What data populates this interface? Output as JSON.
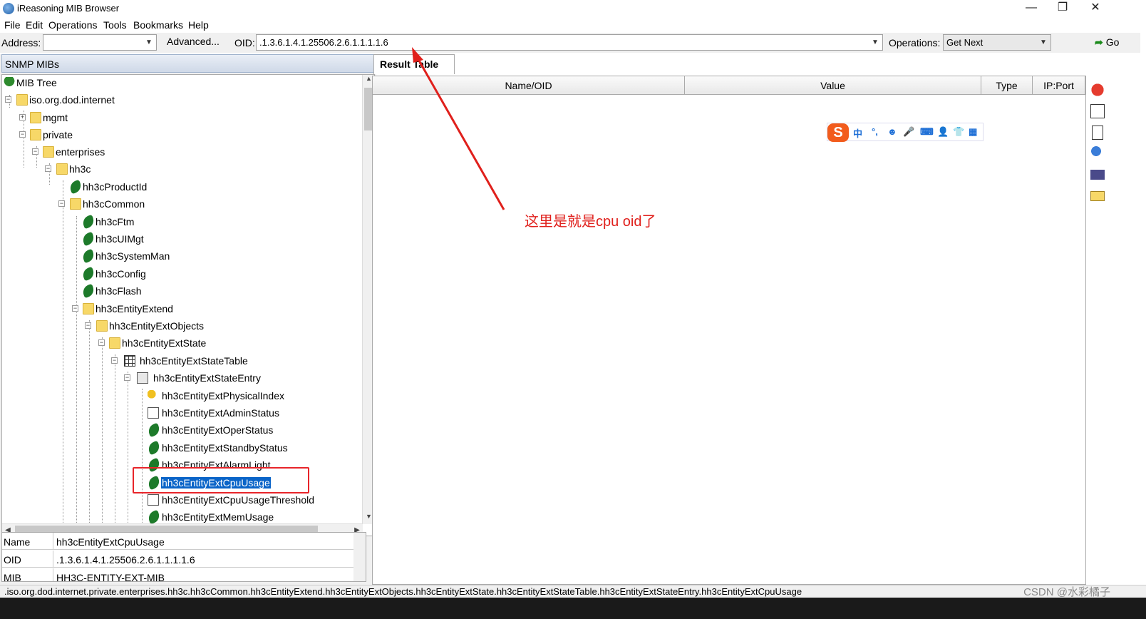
{
  "window": {
    "title": "iReasoning MIB Browser",
    "minimize": "—",
    "maximize": "❐",
    "close": "✕"
  },
  "menu": [
    "File",
    "Edit",
    "Operations",
    "Tools",
    "Bookmarks",
    "Help"
  ],
  "toolbar": {
    "address_label": "Address:",
    "address_value": "",
    "advanced_label": "Advanced...",
    "oid_label": "OID:",
    "oid_value": ".1.3.6.1.4.1.25506.2.6.1.1.1.1.6",
    "operations_label": "Operations:",
    "operations_value": "Get Next",
    "go_label": "Go"
  },
  "left": {
    "header": "SNMP MIBs",
    "tree": [
      {
        "label": "MIB Tree",
        "icon": "tree-icon",
        "expander": ""
      },
      {
        "label": "iso.org.dod.internet",
        "icon": "folder-icon",
        "expander": "−"
      },
      {
        "label": "mgmt",
        "icon": "folder-icon",
        "expander": "+"
      },
      {
        "label": "private",
        "icon": "folder-icon",
        "expander": "−"
      },
      {
        "label": "enterprises",
        "icon": "folder-icon",
        "expander": "−"
      },
      {
        "label": "hh3c",
        "icon": "folder-icon",
        "expander": "−"
      },
      {
        "label": "hh3cProductId",
        "icon": "leaf-icon",
        "expander": ""
      },
      {
        "label": "hh3cCommon",
        "icon": "folder-icon",
        "expander": "−"
      },
      {
        "label": "hh3cFtm",
        "icon": "leaf-icon",
        "expander": ""
      },
      {
        "label": "hh3cUIMgt",
        "icon": "leaf-icon",
        "expander": ""
      },
      {
        "label": "hh3cSystemMan",
        "icon": "leaf-icon",
        "expander": ""
      },
      {
        "label": "hh3cConfig",
        "icon": "leaf-icon",
        "expander": ""
      },
      {
        "label": "hh3cFlash",
        "icon": "leaf-icon",
        "expander": ""
      },
      {
        "label": "hh3cEntityExtend",
        "icon": "folder-icon",
        "expander": "−"
      },
      {
        "label": "hh3cEntityExtObjects",
        "icon": "folder-icon",
        "expander": "−"
      },
      {
        "label": "hh3cEntityExtState",
        "icon": "folder-icon",
        "expander": "−"
      },
      {
        "label": "hh3cEntityExtStateTable",
        "icon": "table-icon",
        "expander": "−"
      },
      {
        "label": "hh3cEntityExtStateEntry",
        "icon": "entry-icon",
        "expander": "−"
      },
      {
        "label": "hh3cEntityExtPhysicalIndex",
        "icon": "key-icon",
        "expander": ""
      },
      {
        "label": "hh3cEntityExtAdminStatus",
        "icon": "edit-icon",
        "expander": ""
      },
      {
        "label": "hh3cEntityExtOperStatus",
        "icon": "leaf-icon",
        "expander": ""
      },
      {
        "label": "hh3cEntityExtStandbyStatus",
        "icon": "leaf-icon",
        "expander": ""
      },
      {
        "label": "hh3cEntityExtAlarmLight",
        "icon": "leaf-icon",
        "expander": ""
      },
      {
        "label": "hh3cEntityExtCpuUsage",
        "icon": "leaf-icon",
        "expander": "",
        "selected": true
      },
      {
        "label": "hh3cEntityExtCpuUsageThreshold",
        "icon": "edit-icon",
        "expander": ""
      },
      {
        "label": "hh3cEntityExtMemUsage",
        "icon": "leaf-icon",
        "expander": ""
      }
    ],
    "details": [
      {
        "key": "Name",
        "value": "hh3cEntityExtCpuUsage"
      },
      {
        "key": "OID",
        "value": ".1.3.6.1.4.1.25506.2.6.1.1.1.1.6"
      },
      {
        "key": "MIB",
        "value": "HH3C-ENTITY-EXT-MIB"
      }
    ]
  },
  "right": {
    "tab_label": "Result Table",
    "columns": [
      "Name/OID",
      "Value",
      "Type",
      "IP:Port"
    ],
    "annotation": "这里是就是cpu oid了",
    "ime_items": [
      "中",
      "°,",
      "☻",
      "🎤",
      "⌨",
      "👤",
      "👕",
      "▦"
    ]
  },
  "statusbar": ".iso.org.dod.internet.private.enterprises.hh3c.hh3cCommon.hh3cEntityExtend.hh3cEntityExtObjects.hh3cEntityExtState.hh3cEntityExtStateTable.hh3cEntityExtStateEntry.hh3cEntityExtCpuUsage",
  "watermark": "CSDN @水彩橘子",
  "colors": {
    "selection": "#0a64c8",
    "annotation": "#e0201c",
    "ime_brand": "#f25c1c"
  }
}
